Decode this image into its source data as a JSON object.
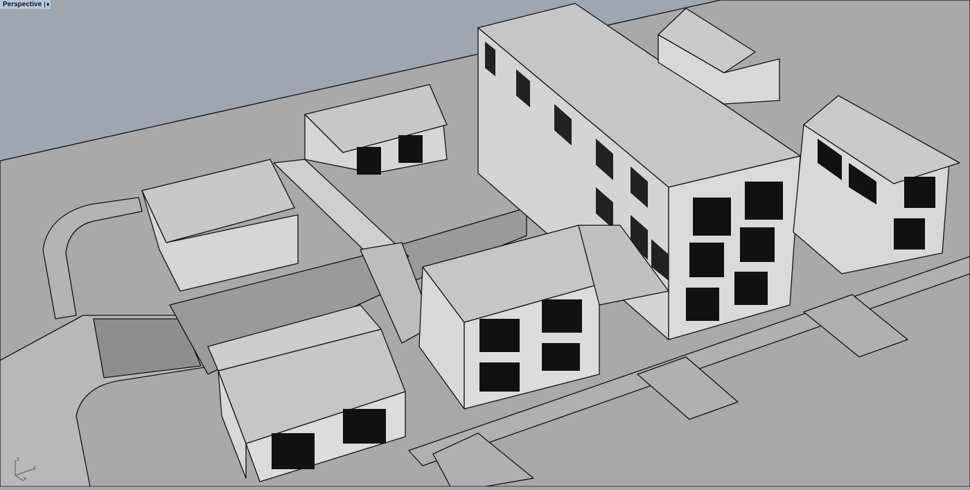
{
  "viewport": {
    "name": "Perspective",
    "menu_icon": "dropdown-arrow-icon",
    "axis_labels": {
      "x": "x",
      "y": "y",
      "z": "z"
    }
  },
  "colors": {
    "sky": "#9ea6ae",
    "ground": "#a9a9a9",
    "wall": "#d6d6d6",
    "roof": "#c8c8c8",
    "outline": "#111111"
  }
}
